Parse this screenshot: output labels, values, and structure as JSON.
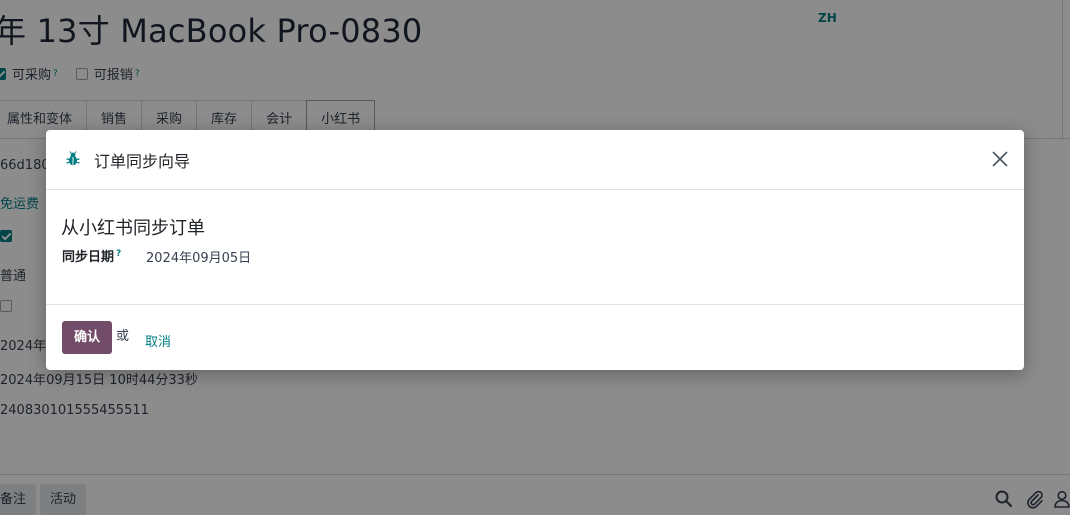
{
  "record": {
    "title": "年 13寸 MacBook Pro-0830",
    "lang": "ZH",
    "checkboxes": [
      {
        "label": "可采购",
        "help": "?",
        "checked": true
      },
      {
        "label": "可报销",
        "help": "?",
        "checked": false
      }
    ],
    "tabs": [
      "属性和变体",
      "销售",
      "采购",
      "库存",
      "会计",
      "小红书"
    ],
    "active_tab": "小红书",
    "fields": {
      "id_partial": "66d180",
      "shipping": "免运费",
      "type": "普通",
      "date_partial": "2024年0",
      "datetime": "2024年09月15日 10时44分33秒",
      "order_no": "240830101555455511"
    }
  },
  "chatter": {
    "note_btn": "备注",
    "activity_btn": "活动"
  },
  "dialog": {
    "title": "订单同步向导",
    "heading": "从小红书同步订单",
    "field_label": "同步日期",
    "field_help": "?",
    "field_value": "2024年09月05日",
    "confirm_label": "确认",
    "or_label": "或",
    "cancel_label": "取消"
  },
  "colors": {
    "primary": "#714b67",
    "link": "#017e84"
  }
}
